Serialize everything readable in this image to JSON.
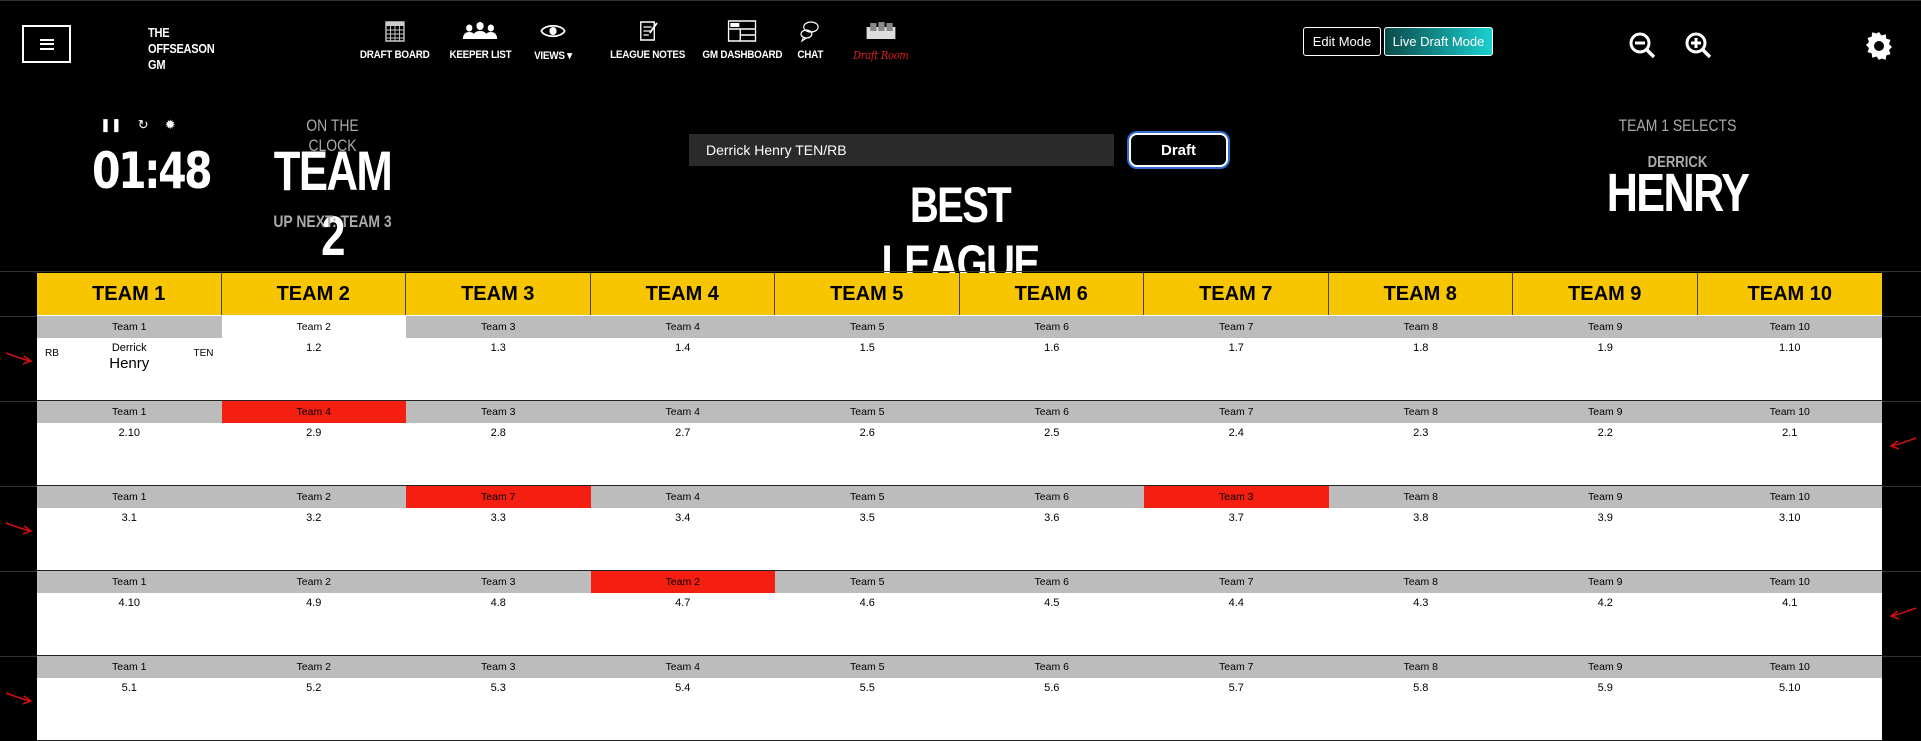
{
  "nav": {
    "brand": [
      "THE",
      "OFFSEASON",
      "GM"
    ],
    "items": [
      {
        "label": "DRAFT BOARD",
        "icon": "calendar-grid-icon"
      },
      {
        "label": "KEEPER LIST",
        "icon": "people-icon"
      },
      {
        "label": "VIEWS",
        "icon": "eye-icon"
      },
      {
        "label": "LEAGUE NOTES",
        "icon": "notepad-icon"
      },
      {
        "label": "GM DASHBOARD",
        "icon": "dashboard-icon"
      },
      {
        "label": "CHAT",
        "icon": "chat-bubbles-icon"
      },
      {
        "label": "Draft Room",
        "icon": "draft-room-icon"
      }
    ],
    "edit_mode": "Edit Mode",
    "live_draft_mode": "Live Draft Mode"
  },
  "clock": {
    "time": "01:48",
    "on_the_clock_label": "ON THE CLOCK",
    "team": "TEAM 2",
    "up_next": "UP NEXT: TEAM 3"
  },
  "draft": {
    "input_value": "Derrick Henry TEN/RB",
    "button": "Draft",
    "league_name": "BEST LEAGUE"
  },
  "last_pick": {
    "label": "TEAM 1 SELECTS",
    "first": "DERRICK",
    "last": "HENRY"
  },
  "teams": [
    "TEAM 1",
    "TEAM 2",
    "TEAM 3",
    "TEAM 4",
    "TEAM 5",
    "TEAM 6",
    "TEAM 7",
    "TEAM 8",
    "TEAM 9",
    "TEAM 10"
  ],
  "rounds": [
    {
      "labels": [
        "Team 1",
        "Team 2",
        "Team 3",
        "Team 4",
        "Team 5",
        "Team 6",
        "Team 7",
        "Team 8",
        "Team 9",
        "Team 10"
      ],
      "picks": [
        "",
        "1.2",
        "1.3",
        "1.4",
        "1.5",
        "1.6",
        "1.7",
        "1.8",
        "1.9",
        "1.10"
      ],
      "traded": []
    },
    {
      "labels": [
        "Team 1",
        "Team 4",
        "Team 3",
        "Team 4",
        "Team 5",
        "Team 6",
        "Team 7",
        "Team 8",
        "Team 9",
        "Team 10"
      ],
      "picks": [
        "2.10",
        "2.9",
        "2.8",
        "2.7",
        "2.6",
        "2.5",
        "2.4",
        "2.3",
        "2.2",
        "2.1"
      ],
      "traded": [
        1
      ]
    },
    {
      "labels": [
        "Team 1",
        "Team 2",
        "Team 7",
        "Team 4",
        "Team 5",
        "Team 6",
        "Team 3",
        "Team 8",
        "Team 9",
        "Team 10"
      ],
      "picks": [
        "3.1",
        "3.2",
        "3.3",
        "3.4",
        "3.5",
        "3.6",
        "3.7",
        "3.8",
        "3.9",
        "3.10"
      ],
      "traded": [
        2,
        6
      ]
    },
    {
      "labels": [
        "Team 1",
        "Team 2",
        "Team 3",
        "Team 2",
        "Team 5",
        "Team 6",
        "Team 7",
        "Team 8",
        "Team 9",
        "Team 10"
      ],
      "picks": [
        "4.10",
        "4.9",
        "4.8",
        "4.7",
        "4.6",
        "4.5",
        "4.4",
        "4.3",
        "4.2",
        "4.1"
      ],
      "traded": [
        3
      ]
    },
    {
      "labels": [
        "Team 1",
        "Team 2",
        "Team 3",
        "Team 4",
        "Team 5",
        "Team 6",
        "Team 7",
        "Team 8",
        "Team 9",
        "Team 10"
      ],
      "picks": [
        "5.1",
        "5.2",
        "5.3",
        "5.4",
        "5.5",
        "5.6",
        "5.7",
        "5.8",
        "5.9",
        "5.10"
      ],
      "traded": []
    }
  ],
  "made_pick": {
    "position": "RB",
    "first": "Derrick",
    "last": "Henry",
    "team": "TEN"
  },
  "colors": {
    "header_yellow": "#f7c600",
    "traded_red": "#f41f10",
    "label_gray": "#bcbcbc",
    "live_mode_cyan": "#1ad0d0"
  }
}
